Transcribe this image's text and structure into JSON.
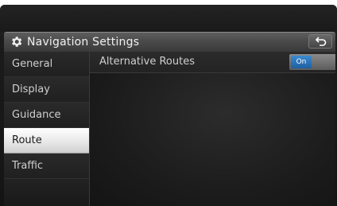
{
  "header": {
    "title": "Navigation Settings",
    "icon": "gear-icon",
    "back_icon": "back-arrow-icon"
  },
  "sidebar": {
    "items": [
      {
        "label": "General",
        "active": false
      },
      {
        "label": "Display",
        "active": false
      },
      {
        "label": "Guidance",
        "active": false
      },
      {
        "label": "Route",
        "active": true
      },
      {
        "label": "Traffic",
        "active": false
      }
    ]
  },
  "content": {
    "options": [
      {
        "label": "Alternative Routes",
        "toggle_value": "On"
      }
    ]
  },
  "colors": {
    "accent": "#2a74b8",
    "active_tab": "#f2f2f2",
    "background": "#1a1a1a"
  }
}
